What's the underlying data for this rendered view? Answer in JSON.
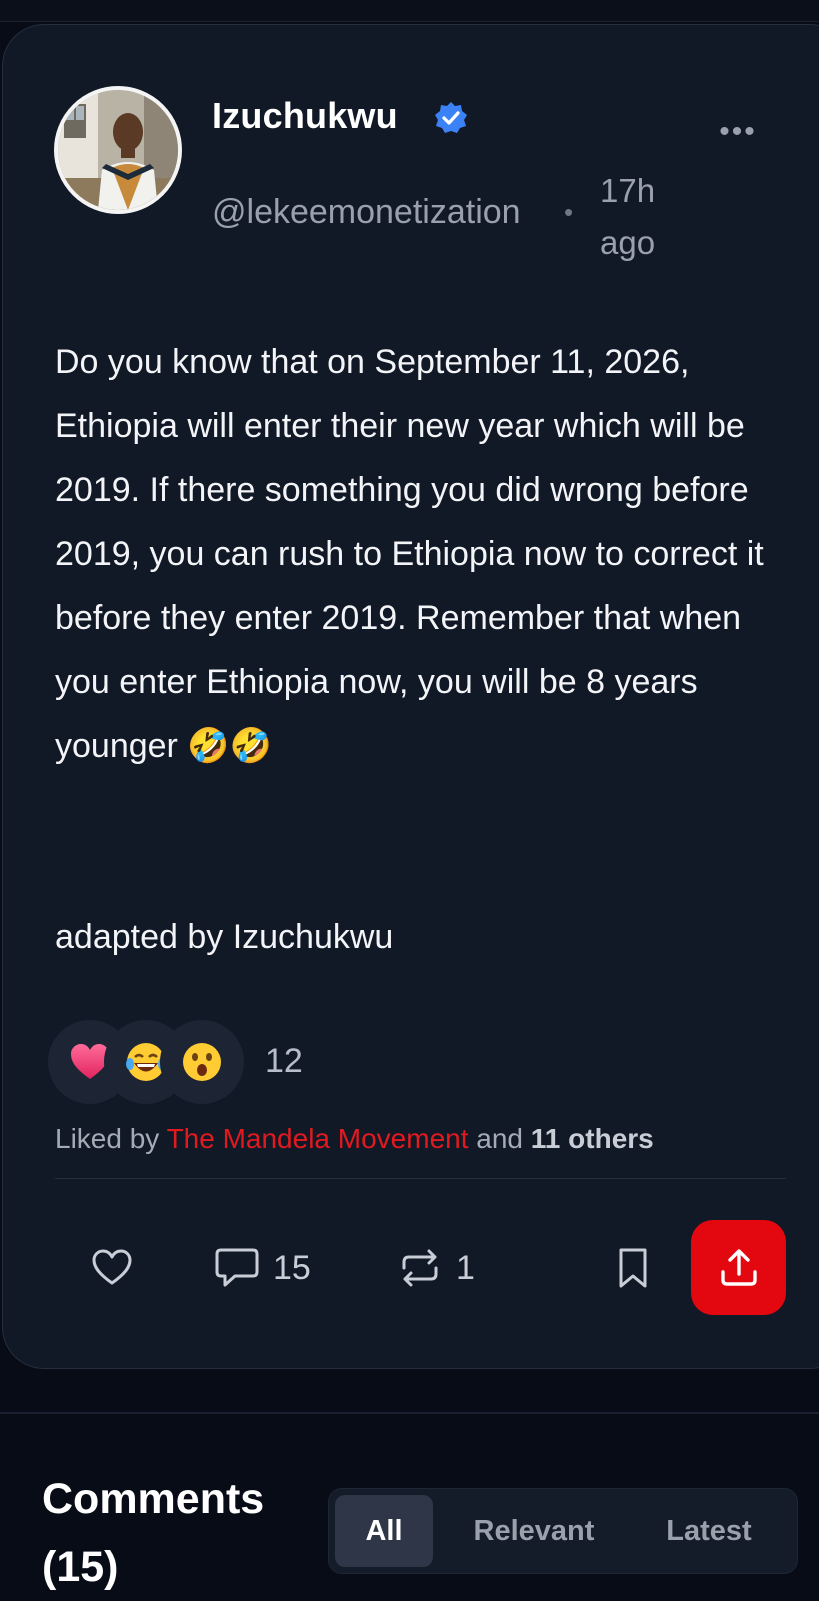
{
  "post": {
    "author_name": "Izuchukwu",
    "handle": "@lekeemonetization",
    "separator": "•",
    "time": "17h ago",
    "more_label": "•••",
    "body": "Do you know that on September 11, 2026, Ethiopia will enter their new year which will be 2019. If there something you did wrong before 2019, you can rush to Ethiopia now to correct it before they enter 2019. Remember that when you enter Ethiopia now, you will be 8 years younger",
    "body_emoji": "🤣🤣",
    "signature": "adapted by Izuchukwu"
  },
  "reactions": {
    "icons": [
      "heart-reaction",
      "laughing-reaction",
      "surprised-reaction"
    ],
    "count": "12"
  },
  "liked_by": {
    "prefix": "Liked by ",
    "name": "The Mandela Movement",
    "middle": " and ",
    "others": "11 others"
  },
  "actions": {
    "comments_count": "15",
    "reposts_count": "1"
  },
  "comments": {
    "title": "Comments (15)",
    "tabs": [
      "All",
      "Relevant",
      "Latest"
    ],
    "active_tab": "All"
  },
  "colors": {
    "background": "#080c17",
    "card": "#111826",
    "accent_red": "#e3080f",
    "verified_blue": "#3b82f6",
    "brand_link": "#e01a1f"
  }
}
